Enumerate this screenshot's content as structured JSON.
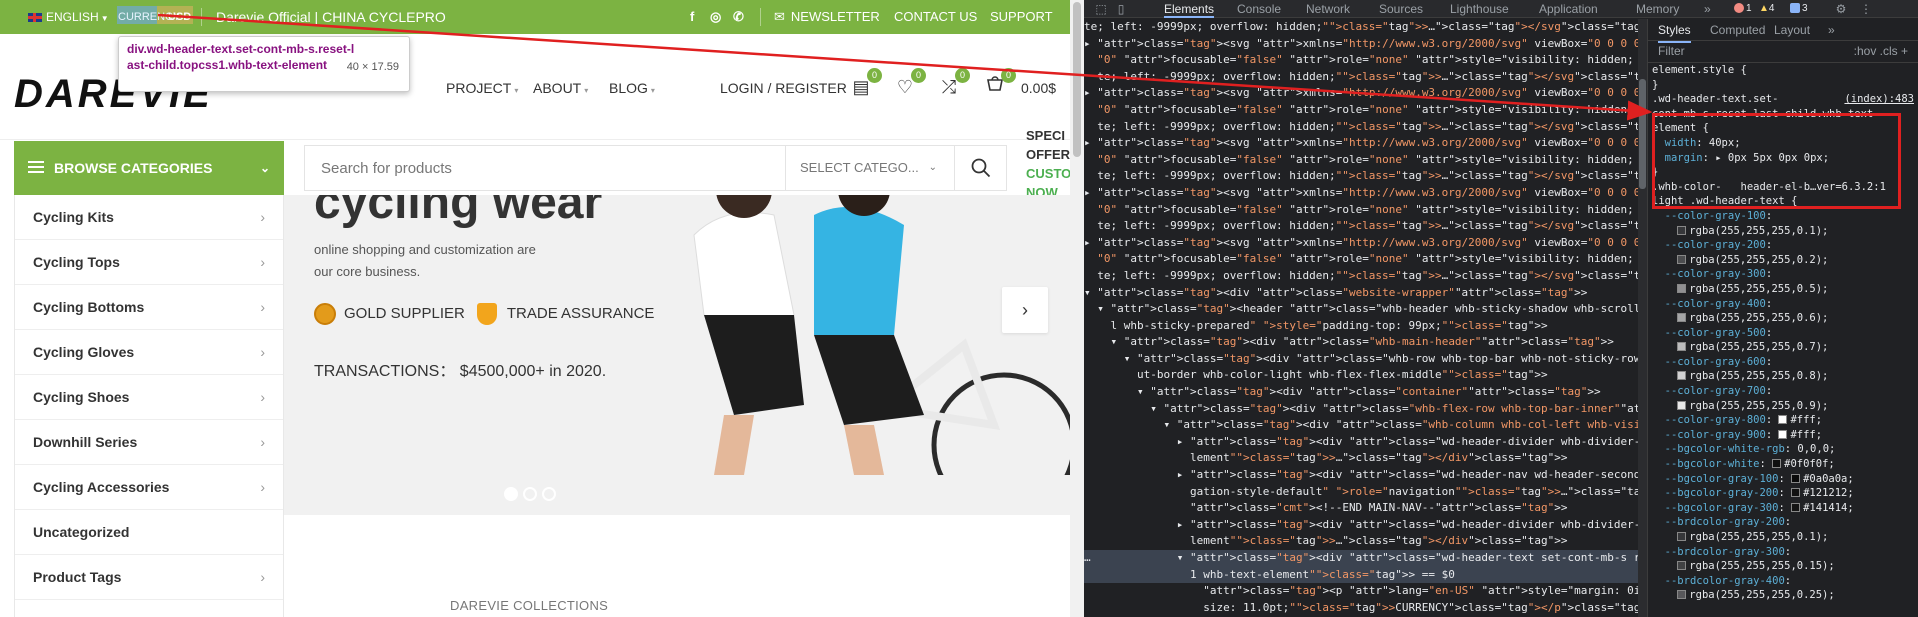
{
  "topbar": {
    "language": "ENGLISH",
    "currency_label": "CURRENCY",
    "currency_value": "USD",
    "site_name": "Darevie Official | CHINA CYCLEPRO",
    "social": [
      "f",
      "◎",
      "✆"
    ],
    "links": [
      "NEWSLETTER",
      "CONTACT US",
      "SUPPORT"
    ]
  },
  "tooltip": {
    "selector": "div.wd-header-text.set-cont-mb-s.reset-last-child.topcss1.whb-text-element",
    "size": "40 × 17.59"
  },
  "header": {
    "logo": "DAREVIE",
    "nav": [
      "PROJECT",
      "ABOUT",
      "BLOG"
    ],
    "login": "LOGIN / REGISTER",
    "badges": {
      "compare_list": "0",
      "wishlist": "0",
      "shuffle": "0",
      "cart": "0"
    },
    "cart_total": "0.00$"
  },
  "categories_button": "BROWSE CATEGORIES",
  "search": {
    "placeholder": "Search for products",
    "category": "SELECT CATEGO..."
  },
  "sidebar": {
    "items": [
      "Cycling Kits",
      "Cycling Tops",
      "Cycling Bottoms",
      "Cycling Gloves",
      "Cycling Shoes",
      "Downhill Series",
      "Cycling Accessories",
      "Uncategorized",
      "Product Tags"
    ]
  },
  "side_note": {
    "line1": "SPECI",
    "line2": "OFFER",
    "line3": "CUSTO",
    "line4": "NOW"
  },
  "hero": {
    "title": "cycling wear",
    "subtitle": "online shopping and customization are our core business.",
    "badge1": "GOLD SUPPLIER",
    "badge2": "TRADE ASSURANCE",
    "transactions": "TRANSACTIONS：  $4500,000+ in 2020."
  },
  "collections_heading": "DAREVIE COLLECTIONS",
  "devtools": {
    "tabs": [
      "Elements",
      "Console",
      "Network",
      "Sources",
      "Lighthouse",
      "Application",
      "Memory"
    ],
    "more": "»",
    "counts": {
      "errors": "1",
      "warnings": "4",
      "messages": "3"
    },
    "styles_tabs": [
      "Styles",
      "Computed",
      "Layout"
    ],
    "filter_placeholder": "Filter",
    "filter_tools": ":hov  .cls  +",
    "colors": {
      "bg": "#202124",
      "accent": "#8ab4f8",
      "site_green": "#7cb342",
      "highlight": "#e02020"
    },
    "style_lines": [
      "element.style {",
      "}",
      ".wd-header-text.set-",
      "cont-mb-s.reset-last-child.whb-text-",
      "element {",
      "  width: 40px;",
      "  margin: ▸ 0px 5px 0px 0px;",
      "}",
      ".whb-color-   header-el-b…ver=6.3.2:1",
      "light .wd-header-text {",
      "  --color-gray-100:",
      "    rgba(255,255,255,0.1);",
      "  --color-gray-200:",
      "    rgba(255,255,255,0.2);",
      "  --color-gray-300:",
      "    rgba(255,255,255,0.5);",
      "  --color-gray-400:",
      "    rgba(255,255,255,0.6);",
      "  --color-gray-500:",
      "    rgba(255,255,255,0.7);",
      "  --color-gray-600:",
      "    rgba(255,255,255,0.8);",
      "  --color-gray-700:",
      "    rgba(255,255,255,0.9);",
      "  --color-gray-800: #fff;",
      "  --color-gray-900: #fff;",
      "  --bgcolor-white-rgb: 0,0,0;",
      "  --bgcolor-white: #0f0f0f;",
      "  --bgcolor-gray-100: #0a0a0a;",
      "  --bgcolor-gray-200: #121212;",
      "  --bgcolor-gray-300: #141414;",
      "  --brdcolor-gray-200:",
      "    rgba(255,255,255,0.1);",
      "  --brdcolor-gray-300:",
      "    rgba(255,255,255,0.15);",
      "  --brdcolor-gray-400:",
      "    rgba(255,255,255,0.25);"
    ],
    "style_source": "(index):483",
    "element_lines": [
      "te; left: -9999px; overflow: hidden;\">…</svg>",
      "▸ <svg xmlns=\"http://www.w3.org/2000/svg\" viewBox=\"0 0 0 0\" width=\"0\" height=",
      "  \"0\" focusable=\"false\" role=\"none\" style=\"visibility: hidden; position: absolu",
      "  te; left: -9999px; overflow: hidden;\">…</svg>",
      "▸ <svg xmlns=\"http://www.w3.org/2000/svg\" viewBox=\"0 0 0 0\" width=\"0\" height=",
      "  \"0\" focusable=\"false\" role=\"none\" style=\"visibility: hidden; position: absolu",
      "  te; left: -9999px; overflow: hidden;\">…</svg>",
      "▸ <svg xmlns=\"http://www.w3.org/2000/svg\" viewBox=\"0 0 0 0\" width=\"0\" height=",
      "  \"0\" focusable=\"false\" role=\"none\" style=\"visibility: hidden; position: absolu",
      "  te; left: -9999px; overflow: hidden;\">…</svg>",
      "▸ <svg xmlns=\"http://www.w3.org/2000/svg\" viewBox=\"0 0 0 0\" width=\"0\" height=",
      "  \"0\" focusable=\"false\" role=\"none\" style=\"visibility: hidden; position: absolu",
      "  te; left: -9999px; overflow: hidden;\">…</svg>",
      "▸ <svg xmlns=\"http://www.w3.org/2000/svg\" viewBox=\"0 0 0 0\" width=\"0\" height=",
      "  \"0\" focusable=\"false\" role=\"none\" style=\"visibility: hidden; position: absolu",
      "  te; left: -9999px; overflow: hidden;\">…</svg>",
      "▾ <div class=\"website-wrapper\">",
      "  ▾ <header class=\"whb-header whb-sticky-shadow whb-scroll-slide whb-sticky-rea",
      "    l whb-sticky-prepared\" style=\"padding-top: 99px;\">",
      "    ▾ <div class=\"whb-main-header\">",
      "      ▾ <div class=\"whb-row whb-top-bar whb-not-sticky-row whb-with-bg whb-witho",
      "        ut-border whb-color-light whb-flex-flex-middle\">",
      "        ▾ <div class=\"container\">",
      "          ▾ <div class=\"whb-flex-row whb-top-bar-inner\"> flex",
      "            ▾ <div class=\"whb-column whb-col-left whb-visible-lg\"> flex",
      "              ▸ <div class=\"wd-header-divider whb-divider-default  whb-divider-e",
      "                lement\">…</div>",
      "              ▸ <div class=\"wd-header-nav wd-header-secondary-nav text-left navi",
      "                gation-style-default\" role=\"navigation\">…</div>",
      "                <!--END MAIN-NAV-->",
      "              ▸ <div class=\"wd-header-divider whb-divider-default  whb-divider-e",
      "                lement\">…</div>",
      "…             ▾ <div class=\"wd-header-text set-cont-mb-s reset-last-child topcss",
      "                1 whb-text-element\"> == $0",
      "                  <p lang=\"en-US\" style=\"margin: 0in; font-family: Calibri; font-",
      "                  size: 11.0pt;\">CURRENCY</p>"
    ]
  }
}
